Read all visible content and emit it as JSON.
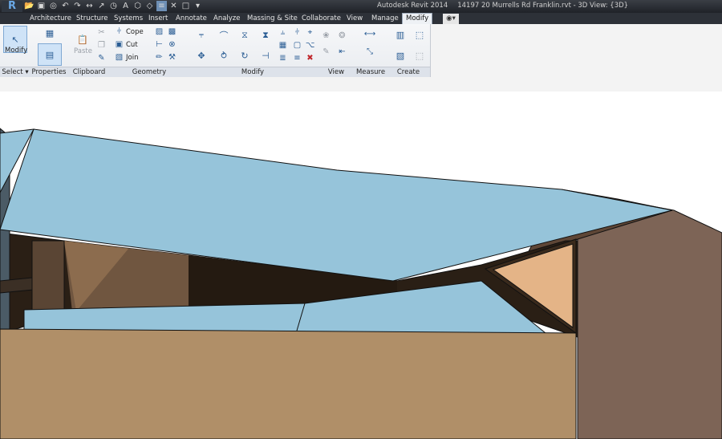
{
  "window": {
    "title": "Autodesk Revit 2014",
    "document": "14197 20 Murrells Rd Franklin.rvt - 3D View: {3D}",
    "logo": "R"
  },
  "tabs": [
    {
      "label": "Architecture",
      "active": false
    },
    {
      "label": "Structure",
      "active": false
    },
    {
      "label": "Systems",
      "active": false
    },
    {
      "label": "Insert",
      "active": false
    },
    {
      "label": "Annotate",
      "active": false
    },
    {
      "label": "Analyze",
      "active": false
    },
    {
      "label": "Massing & Site",
      "active": false
    },
    {
      "label": "Collaborate",
      "active": false
    },
    {
      "label": "View",
      "active": false
    },
    {
      "label": "Manage",
      "active": false
    },
    {
      "label": "Modify",
      "active": true
    }
  ],
  "panels": {
    "select": {
      "label": "Select",
      "modify_label": "Modify"
    },
    "properties": {
      "label": "Properties"
    },
    "clipboard": {
      "label": "Clipboard",
      "paste_label": "Paste"
    },
    "geometry": {
      "label": "Geometry",
      "cope_label": "Cope",
      "cut_label": "Cut",
      "join_label": "Join"
    },
    "modify": {
      "label": "Modify"
    },
    "view": {
      "label": "View"
    },
    "measure": {
      "label": "Measure"
    },
    "create": {
      "label": "Create"
    }
  },
  "icons": [
    "open-icon",
    "save-icon",
    "undo-icon",
    "redo-icon",
    "measure-icon",
    "text-icon",
    "3d-view-icon",
    "modify-cursor-icon",
    "properties-icon",
    "paste-icon",
    "cut-icon",
    "copy-icon",
    "match-icon",
    "cope-icon",
    "align-icon",
    "move-icon",
    "rotate-icon",
    "mirror-icon",
    "array-icon",
    "scale-icon",
    "delete-icon",
    "create-group-icon",
    "create-parts-icon"
  ],
  "colors": {
    "roof": "#96c4da",
    "wall_exterior": "#b08f68",
    "wall_side": "#7d6456",
    "wall_dark": "#4e3b2a",
    "gable": "#e4b487",
    "active_tab": "#eef1f5"
  }
}
